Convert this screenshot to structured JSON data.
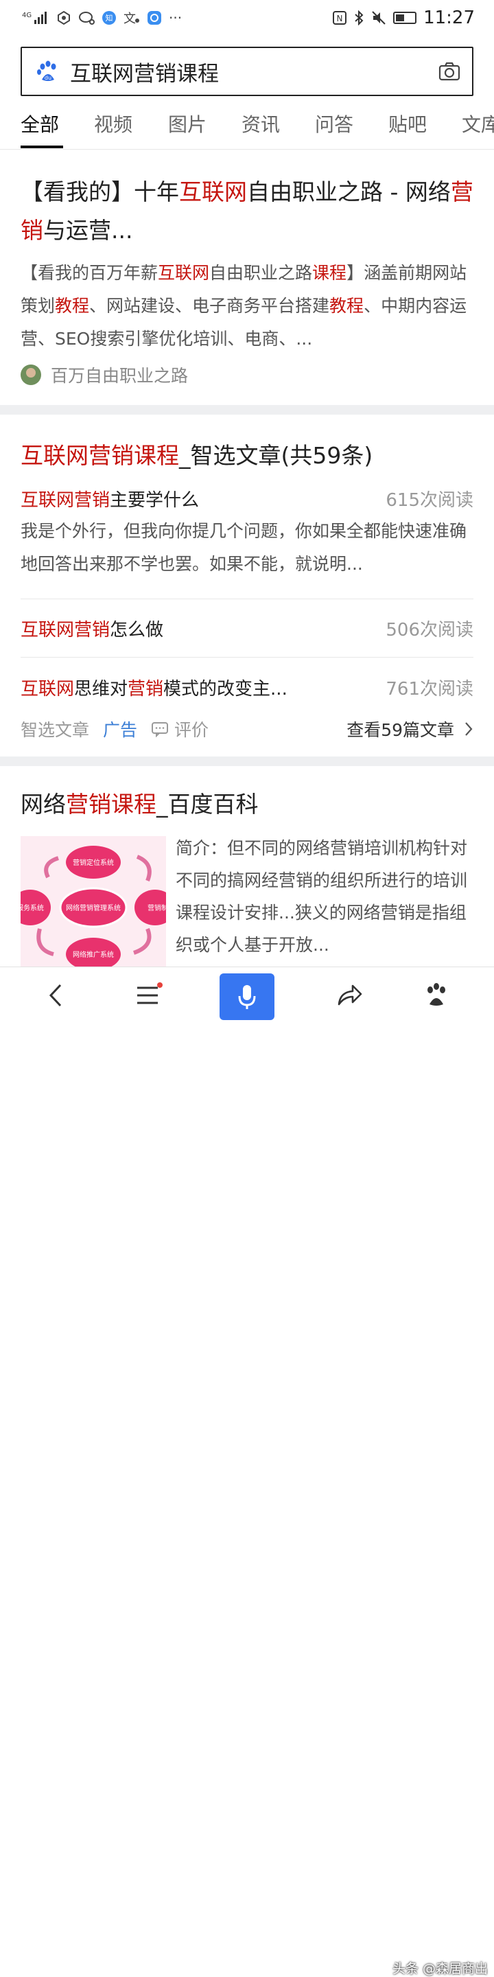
{
  "status_bar": {
    "signal": "4G",
    "time": "11:27",
    "left_icons": [
      "signal-icon",
      "hexagon-app-icon",
      "chat-icon",
      "zhihu-icon",
      "translate-icon",
      "app-icon",
      "more-icon"
    ],
    "right_icons": [
      "nfc-icon",
      "bluetooth-icon",
      "mute-icon",
      "battery-icon"
    ]
  },
  "search": {
    "query": "互联网营销课程"
  },
  "tabs": [
    "全部",
    "视频",
    "图片",
    "资讯",
    "问答",
    "贴吧",
    "文库"
  ],
  "result1": {
    "title_parts": [
      {
        "text": "【看我的】十年",
        "hl": false
      },
      {
        "text": "互联网",
        "hl": true
      },
      {
        "text": "自由职业之路 - 网络",
        "hl": false
      },
      {
        "text": "营销",
        "hl": true
      },
      {
        "text": "与运营...",
        "hl": false
      }
    ],
    "desc_parts": [
      {
        "text": "【看我的百万年薪",
        "hl": false
      },
      {
        "text": "互联网",
        "hl": true
      },
      {
        "text": "自由职业之路",
        "hl": false
      },
      {
        "text": "课程",
        "hl": true
      },
      {
        "text": "】涵盖前期网站策划",
        "hl": false
      },
      {
        "text": "教程",
        "hl": true
      },
      {
        "text": "、网站建设、电子商务平台搭建",
        "hl": false
      },
      {
        "text": "教程",
        "hl": true
      },
      {
        "text": "、中期内容运营、SEO搜索引擎优化培训、电商、...",
        "hl": false
      }
    ],
    "source": "百万自由职业之路"
  },
  "result2": {
    "title_hl": "互联网营销课程",
    "title_rest": "_智选文章(共59条)",
    "items": [
      {
        "hl1": "互联网营销",
        "rest": "主要学什么",
        "reads": "615次阅读"
      },
      {
        "hl1": "互联网营销",
        "rest": "怎么做",
        "reads": "506次阅读"
      },
      {
        "hl1": "互联网",
        "mid": "思维对",
        "hl2": "营销",
        "rest": "模式的改变主...",
        "reads": "761次阅读"
      }
    ],
    "first_desc": "我是个外行，但我向你提几个问题，你如果全都能快速准确地回答出来那不学也罢。如果不能，就说明...",
    "footer": {
      "source": "智选文章",
      "ad": "广告",
      "comment": "评价",
      "view_all": "查看59篇文章"
    }
  },
  "result3": {
    "title_pre": "网络",
    "title_hl": "营销课程",
    "title_rest": "_百度百科",
    "desc": "简介：但不同的网络营销培训机构针对不同的搞网经营销的组织所进行的培训课程设计安排...狭义的网络营销是指组织或个人基于开放...",
    "thumb": {
      "center": "网络营销管理系统",
      "top": "营销定位系统",
      "right": "营销制",
      "bottom": "网络推广系统",
      "left": "服务系统"
    }
  },
  "bottom_bar": {
    "icons": [
      "back-icon",
      "menu-icon",
      "mic-icon",
      "share-icon",
      "paw-icon"
    ]
  },
  "watermark": "头条 @森居商出"
}
